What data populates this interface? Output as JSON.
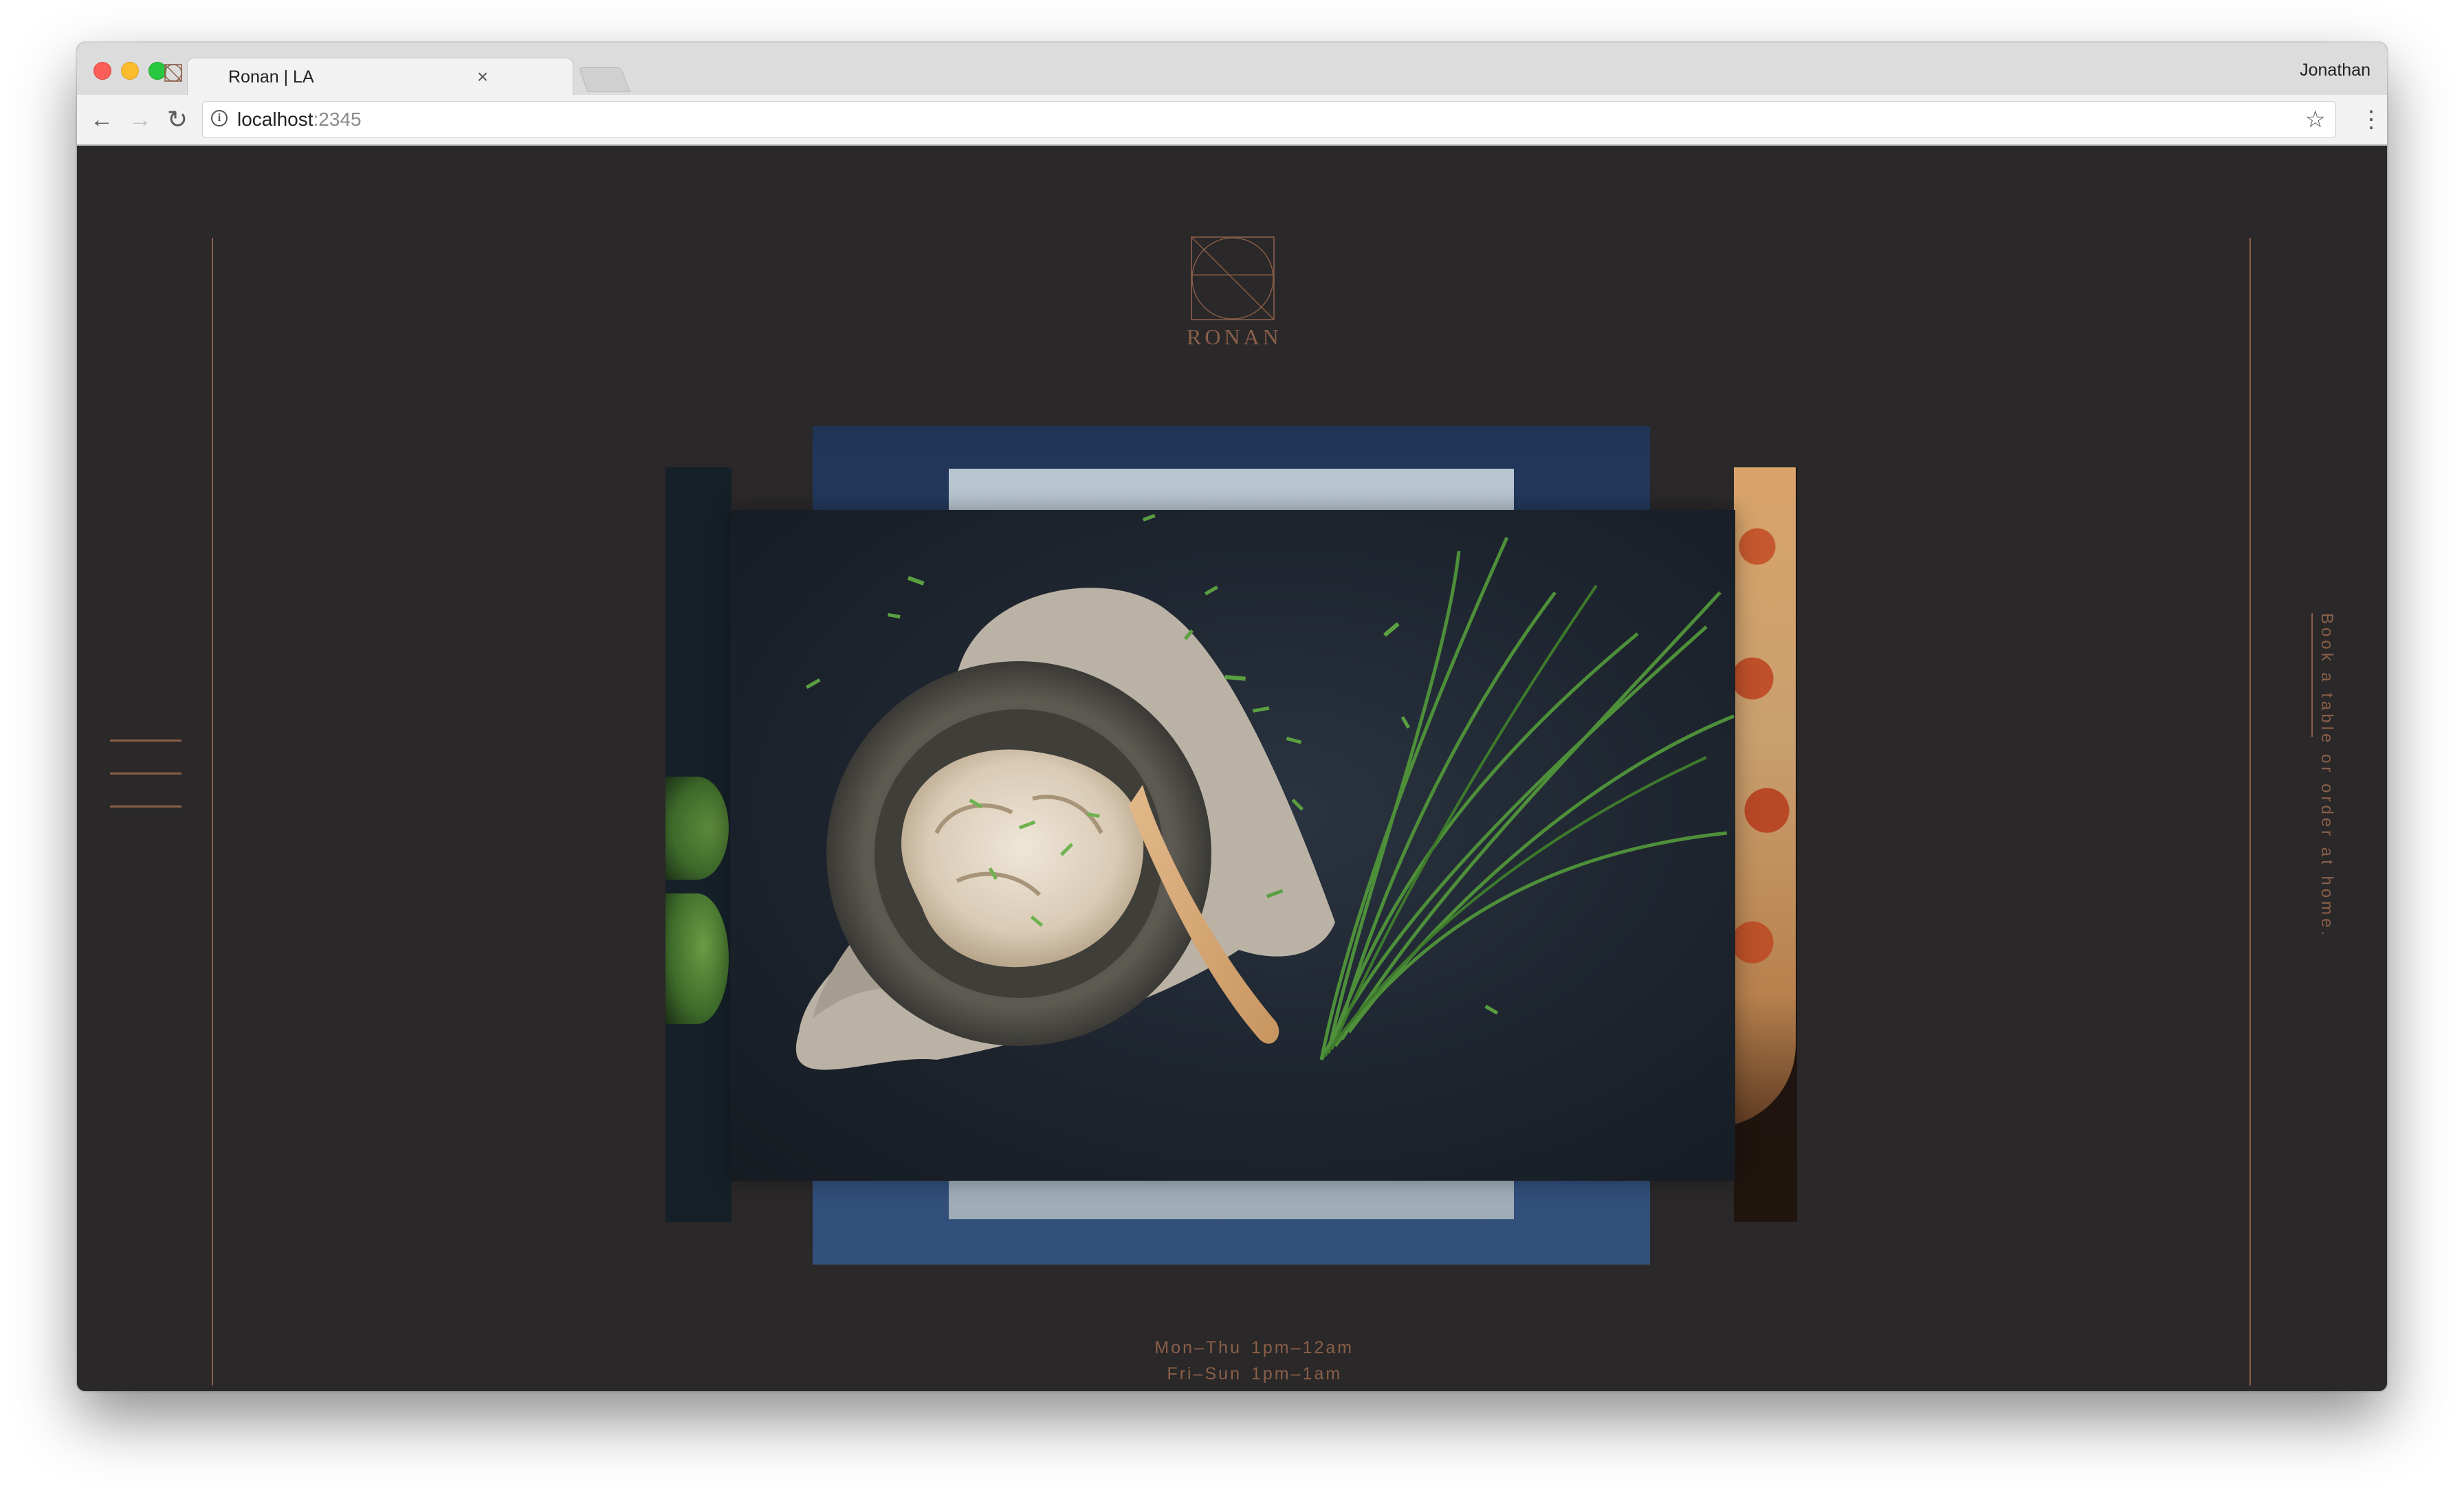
{
  "browser": {
    "tab_title": "Ronan | LA",
    "tab_close": "×",
    "profile_name": "Jonathan",
    "url_host": "localhost",
    "url_port": ":2345",
    "back_glyph": "←",
    "forward_glyph": "→",
    "reload_glyph": "↻",
    "info_glyph": "i",
    "star_glyph": "☆",
    "menu_glyph": "⋮"
  },
  "site": {
    "logo_text": "RONAN",
    "booking_text": "Book a table or order at home.",
    "hours": [
      {
        "days": "Mon–Thu",
        "time": "1pm–12am"
      },
      {
        "days": "Fri–Sun",
        "time": "1pm–1am"
      }
    ]
  },
  "colors": {
    "page_background": "#2a2829",
    "accent_copper": "#8a5f49",
    "chrome_tabbar": "#dcdcdc",
    "chrome_toolbar": "#f2f2f2"
  },
  "icons": {
    "menu": "hamburger-icon",
    "favicon": "ronan-logo-icon",
    "logo": "ronan-logo-mark"
  }
}
